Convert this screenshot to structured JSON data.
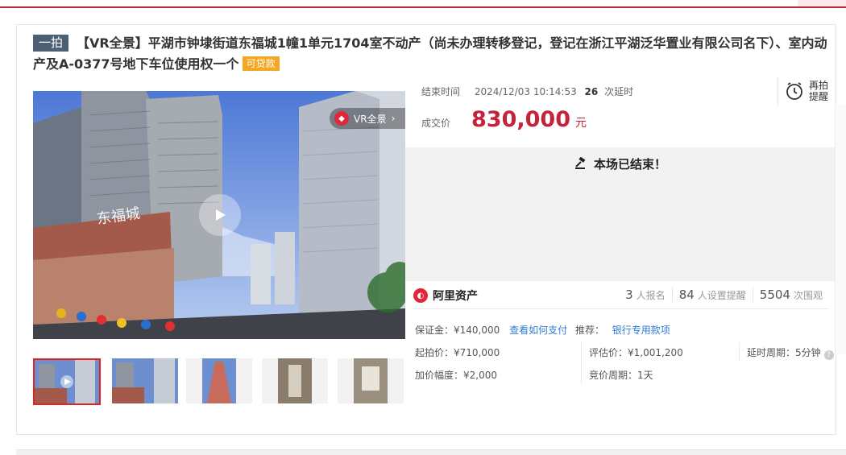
{
  "header": {
    "accent": "#c4243b"
  },
  "title": {
    "badge": "一拍",
    "text": "【VR全景】平湖市钟埭街道东福城1幢1单元1704室不动产（尚未办理转移登记，登记在浙江平湖泛华置业有限公司名下）、室内动产及A-0377号地下车位使用权一个",
    "loan_tag": "可贷款"
  },
  "media": {
    "vr_label": "VR全景",
    "thumbnails": [
      "thumb-video",
      "thumb-exterior-1",
      "thumb-exterior-2",
      "thumb-hallway",
      "thumb-room"
    ]
  },
  "auction": {
    "end_label": "结束时间",
    "end_time": "2024/12/03 10:14:53",
    "delay_count": "26",
    "delay_label": "次延时",
    "remind_label_1": "再拍",
    "remind_label_2": "提醒",
    "deal_label": "成交价",
    "deal_price": "830,000",
    "deal_unit": "元",
    "ended_text": "本场已结束！"
  },
  "stats": {
    "platform": "阿里资产",
    "signups": "3",
    "signups_label": "人报名",
    "reminders": "84",
    "reminders_label": "人设置提醒",
    "views": "5504",
    "views_label": "次围观"
  },
  "details": {
    "deposit": "保证金：¥140,000",
    "how_to_pay": "查看如何支付",
    "recommend_label": "推荐：",
    "recommend_link": "银行专用款项",
    "start_price": "起拍价：¥710,000",
    "appraisal": "评估价：¥1,001,200",
    "delay_period": "延时周期：5分钟",
    "increment": "加价幅度：¥2,000",
    "bid_period": "竞价周期：1天"
  }
}
